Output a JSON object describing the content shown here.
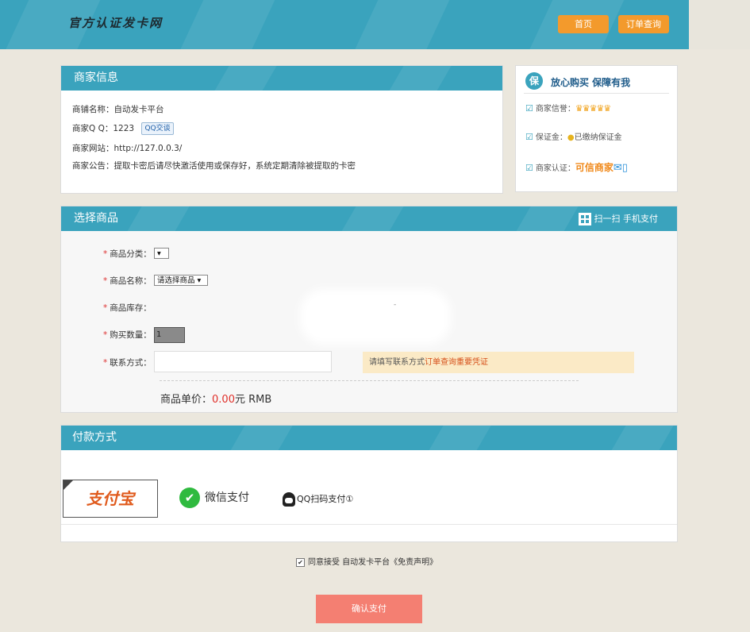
{
  "header": {
    "logo_text": "官方认证发卡网",
    "home_label": "首页",
    "order_query_label": "订单查询"
  },
  "merchant": {
    "section_title": "商家信息",
    "shop_name": "商铺名称：自动发卡平台",
    "qq": "商家Q Q：1223",
    "qq_button": "QQ交谈",
    "website": "商家网站：http://127.0.0.3/",
    "notice": "商家公告：提取卡密后请尽快激活使用或保存好，系统定期清除被提取的卡密"
  },
  "guarantee": {
    "shield_char": "保",
    "title": "放心购买   保障有我",
    "credit_label": "商家信誉：",
    "credit_stars": "♛♛♛♛♛",
    "deposit_label": "保证金：",
    "deposit_value": "已缴纳保证金",
    "cert_label": "商家认证：",
    "cert_value": "可信商家",
    "cert_icons": "✉▯"
  },
  "product": {
    "section_title": "选择商品",
    "scan_label": "扫一扫 手机支付",
    "category_label": "商品分类：",
    "category_value": "",
    "name_label": "商品名称：",
    "name_value": "请选择商品",
    "stock_label": "商品库存：",
    "stock_value": "-",
    "qty_label": "购买数量：",
    "qty_value": "1",
    "contact_label": "联系方式：",
    "contact_tip": "请填写联系方式",
    "contact_tip_red": "订单查询重要凭证",
    "required_mark": "*",
    "price_label": "商品单价：",
    "price_value": "0.00",
    "price_unit": "元 RMB"
  },
  "payment": {
    "section_title": "付款方式",
    "alipay_label": "支付宝",
    "wechat_label": "微信支付",
    "wechat_icon": "✔",
    "qq_label": "QQ扫码支付①"
  },
  "footer": {
    "agree_check": "✔",
    "agree_text": "同意接受 自动发卡平台《免责声明》",
    "pay_button": "确认支付"
  }
}
